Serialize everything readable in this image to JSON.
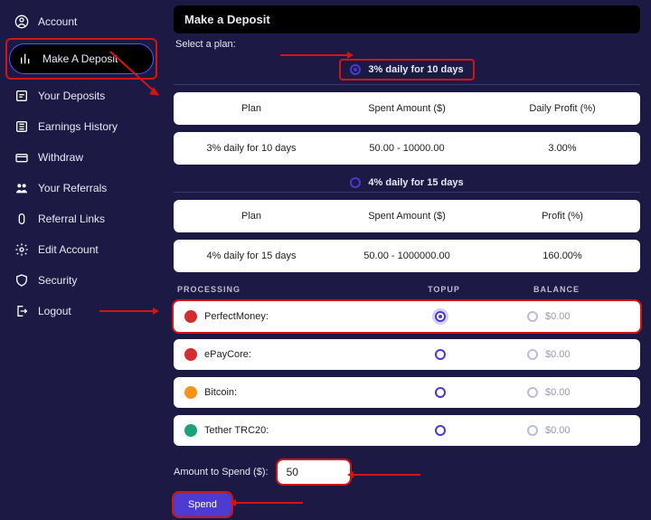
{
  "sidebar": {
    "items": [
      {
        "label": "Account",
        "icon": "user-circle-icon"
      },
      {
        "label": "Make A Deposit",
        "icon": "chart-icon"
      },
      {
        "label": "Your Deposits",
        "icon": "deposits-icon"
      },
      {
        "label": "Earnings History",
        "icon": "history-icon"
      },
      {
        "label": "Withdraw",
        "icon": "withdraw-icon"
      },
      {
        "label": "Your Referrals",
        "icon": "referrals-icon"
      },
      {
        "label": "Referral Links",
        "icon": "link-icon"
      },
      {
        "label": "Edit Account",
        "icon": "gear-icon"
      },
      {
        "label": "Security",
        "icon": "shield-icon"
      },
      {
        "label": "Logout",
        "icon": "logout-icon"
      }
    ],
    "activeIndex": 1
  },
  "header": {
    "title": "Make a Deposit",
    "subtitle": "Select a plan:"
  },
  "plans": [
    {
      "selectLabel": "3% daily for 10 days",
      "selected": true,
      "highlight": true,
      "headers": {
        "plan": "Plan",
        "spent": "Spent Amount ($)",
        "profit": "Daily Profit (%)"
      },
      "row": {
        "plan": "3% daily for 10 days",
        "spent": "50.00 - 10000.00",
        "profit": "3.00%"
      }
    },
    {
      "selectLabel": "4% daily for 15 days",
      "selected": false,
      "headers": {
        "plan": "Plan",
        "spent": "Spent Amount ($)",
        "profit": "Profit (%)"
      },
      "row": {
        "plan": "4% daily for 15 days",
        "spent": "50.00 - 1000000.00",
        "profit": "160.00%"
      }
    }
  ],
  "processingHeaders": {
    "processing": "PROCESSING",
    "topup": "TOPUP",
    "balance": "BALANCE"
  },
  "processors": [
    {
      "name": "PerfectMoney:",
      "balance": "$0.00",
      "selected": true,
      "highlight": true,
      "coin": "pm"
    },
    {
      "name": "ePayCore:",
      "balance": "$0.00",
      "selected": false,
      "coin": "ep"
    },
    {
      "name": "Bitcoin:",
      "balance": "$0.00",
      "selected": false,
      "coin": "btc"
    },
    {
      "name": "Tether TRC20:",
      "balance": "$0.00",
      "selected": false,
      "coin": "usdt"
    }
  ],
  "amount": {
    "label": "Amount to Spend ($):",
    "value": "50"
  },
  "actions": {
    "spend": "Spend"
  }
}
